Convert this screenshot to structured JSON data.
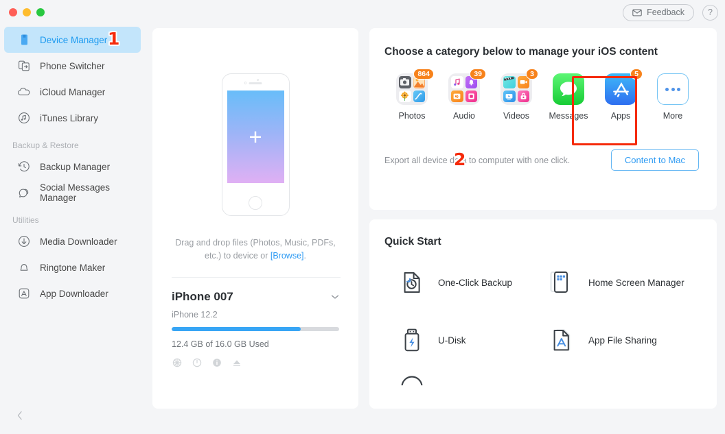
{
  "window": {
    "traffic_lights": [
      "close",
      "minimize",
      "zoom"
    ]
  },
  "topbar": {
    "feedback_label": "Feedback",
    "feedback_icon": "envelope-icon",
    "help_label": "?",
    "help_icon": "question-mark-icon"
  },
  "sidebar": {
    "items": [
      {
        "label": "Device Manager",
        "icon": "device-icon",
        "active": true
      },
      {
        "label": "Phone Switcher",
        "icon": "phone-switch-icon",
        "active": false
      },
      {
        "label": "iCloud Manager",
        "icon": "cloud-icon",
        "active": false
      },
      {
        "label": "iTunes Library",
        "icon": "music-note-circle-icon",
        "active": false
      }
    ],
    "group_backup_label": "Backup & Restore",
    "backup_items": [
      {
        "label": "Backup Manager",
        "icon": "clock-restore-icon"
      },
      {
        "label": "Social Messages Manager",
        "icon": "chat-bubble-icon"
      }
    ],
    "group_utilities_label": "Utilities",
    "utility_items": [
      {
        "label": "Media Downloader",
        "icon": "download-circle-icon"
      },
      {
        "label": "Ringtone Maker",
        "icon": "bell-icon"
      },
      {
        "label": "App Downloader",
        "icon": "app-store-square-icon"
      }
    ],
    "collapse_icon": "chevron-left-icon"
  },
  "markers": {
    "one": "1",
    "two": "2"
  },
  "device_panel": {
    "phone_illustration": "iphone-outline-icon",
    "add_icon": "plus-icon",
    "drag_text_1": "Drag and drop files (Photos, Music, PDFs,",
    "drag_text_2": "etc.) to device or ",
    "browse_link": "[Browse]",
    "drag_text_3": ".",
    "device_name": "iPhone 007",
    "expand_icon": "chevron-down-icon",
    "os_version": "iPhone 12.2",
    "storage_percent": 77,
    "storage_text": "12.4 GB of  16.0 GB Used",
    "actions": [
      {
        "icon": "refresh-icon"
      },
      {
        "icon": "power-icon"
      },
      {
        "icon": "info-icon"
      },
      {
        "icon": "eject-icon"
      }
    ]
  },
  "category_section": {
    "title": "Choose a category below to manage your iOS content",
    "categories": [
      {
        "label": "Photos",
        "badge": "864",
        "icon": "photos-folder-icon",
        "highlighted": false
      },
      {
        "label": "Audio",
        "badge": "39",
        "icon": "audio-folder-icon",
        "highlighted": true
      },
      {
        "label": "Videos",
        "badge": "3",
        "icon": "videos-folder-icon",
        "highlighted": false
      },
      {
        "label": "Messages",
        "badge": "",
        "icon": "messages-icon",
        "highlighted": false
      },
      {
        "label": "Apps",
        "badge": "5",
        "icon": "app-store-icon",
        "highlighted": false
      },
      {
        "label": "More",
        "badge": "",
        "icon": "more-ellipsis-icon",
        "highlighted": false
      }
    ],
    "export_text": "Export all device data to computer with one click.",
    "content_button_label": "Content to Mac"
  },
  "quick_start": {
    "title": "Quick Start",
    "items": [
      {
        "label": "One-Click Backup",
        "icon": "one-click-backup-icon"
      },
      {
        "label": "Home Screen Manager",
        "icon": "home-screen-manager-icon"
      },
      {
        "label": "U-Disk",
        "icon": "usb-drive-icon"
      },
      {
        "label": "App File Sharing",
        "icon": "app-file-sharing-icon"
      }
    ],
    "partial_item_icon": "circular-progress-icon"
  },
  "colors": {
    "accent": "#2e9bf3",
    "sidebar_active_bg": "#c3e5fb",
    "badge": "#f7821b",
    "marker_red": "#f52a0a",
    "storage_bar": "#37a5f5"
  }
}
